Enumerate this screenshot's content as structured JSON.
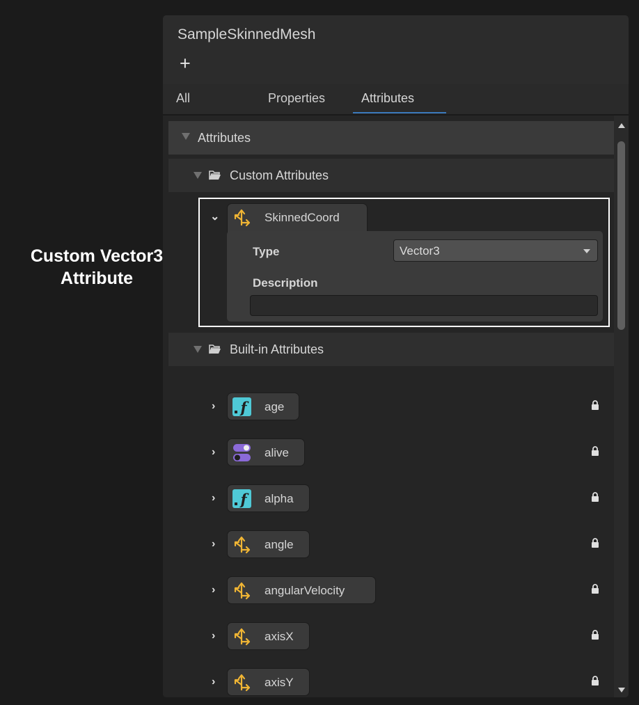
{
  "caption": {
    "line1": "Custom Vector3",
    "line2": "Attribute"
  },
  "window": {
    "title": "SampleSkinnedMesh",
    "add_label": "+"
  },
  "tabs": [
    {
      "label": "All"
    },
    {
      "label": "Properties"
    },
    {
      "label": "Attributes"
    }
  ],
  "active_tab": "Attributes",
  "section": {
    "label": "Attributes"
  },
  "custom_group": {
    "label": "Custom Attributes",
    "attribute": {
      "name": "SkinnedCoord",
      "icon": "vector3-icon",
      "type_label": "Type",
      "type_value": "Vector3",
      "description_label": "Description",
      "description_value": ""
    }
  },
  "builtin_group": {
    "label": "Built-in Attributes",
    "items": [
      {
        "name": "age",
        "icon": "float-icon"
      },
      {
        "name": "alive",
        "icon": "bool-icon"
      },
      {
        "name": "alpha",
        "icon": "float-icon"
      },
      {
        "name": "angle",
        "icon": "vector3-icon"
      },
      {
        "name": "angularVelocity",
        "icon": "vector3-icon"
      },
      {
        "name": "axisX",
        "icon": "vector3-icon"
      },
      {
        "name": "axisY",
        "icon": "vector3-icon"
      }
    ]
  },
  "colors": {
    "float": "#4fc9d6",
    "bool": "#8b6ad8",
    "vector3": "#f0b534",
    "tab_underline": "#3a79bb",
    "highlight_border": "#ffffff"
  }
}
